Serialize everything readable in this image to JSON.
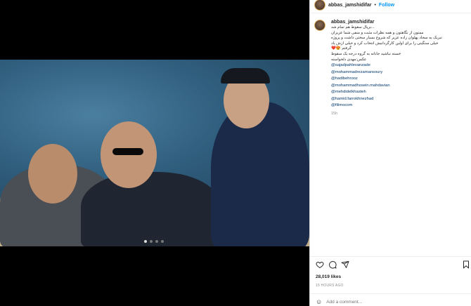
{
  "post": {
    "username": "abbas_jamshidifar",
    "separator": "•",
    "follow_label": "Follow"
  },
  "caption": {
    "username": "abbas_jamshidifar",
    "lines": [
      "...برپال سقوط هم تمام شد",
      "ممنون از نگاهتون و همه نظرات مثبت و منفی شما عزیزان",
      "تبریک به سجاد پهلوان زاده عزیز که شروع بسیار سختی داشت و پروژه",
      "خیلی سنگینی را برای اولین کارگردانیش انتخاب کرد و خیلی ازش یاد",
      "گرفتم 😍❤️",
      "خسته نباشید جانانه به گروه درجه یک سقوط",
      "عکس:مهدی دلخواسته"
    ],
    "mentions": [
      "@sajadpahlevanzade",
      "@mohammadrezamansoury",
      "@hadibehrooz",
      "@mohammadhosein.mahdavian",
      "@mehdidelkhasteh",
      "@hamid.farrokhnezhad",
      "@filimocom"
    ],
    "age": "15h"
  },
  "stats": {
    "likes": "28,019 likes",
    "time": "15 HOURS AGO"
  },
  "comment_box": {
    "placeholder": "Add a comment..."
  },
  "icons": {
    "like": "heart-icon",
    "comment": "comment-icon",
    "share": "share-icon",
    "save": "bookmark-icon",
    "emoji": "emoji-icon"
  },
  "carousel": {
    "count": 4,
    "active_index": 0
  }
}
